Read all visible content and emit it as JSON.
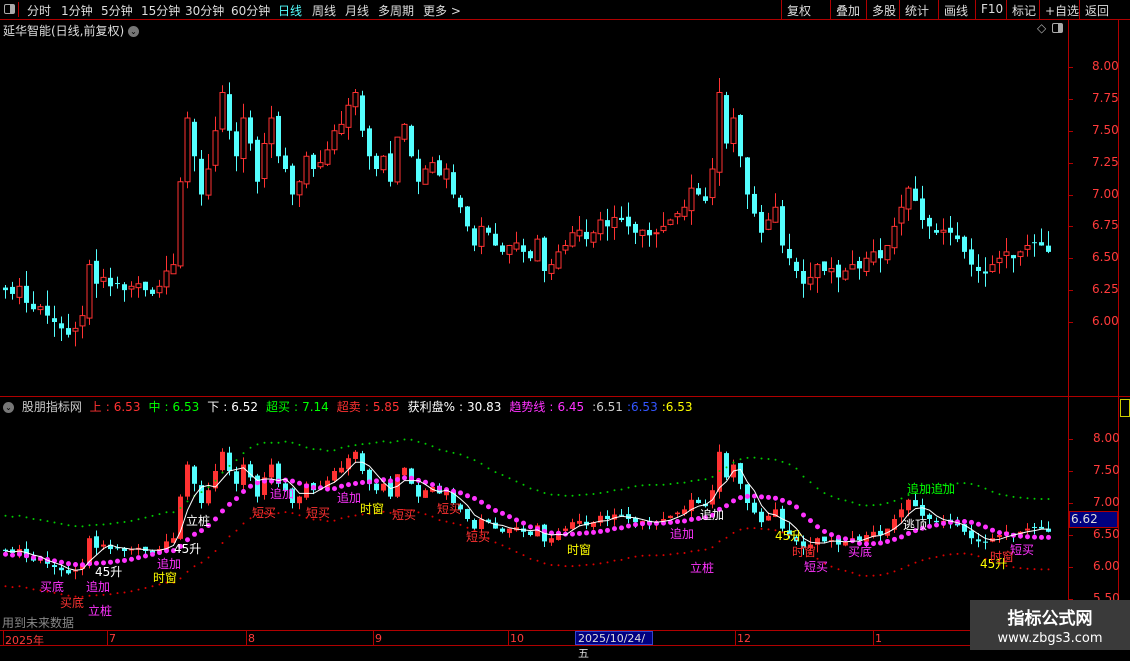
{
  "toolbar": {
    "periods": [
      "分时",
      "1分钟",
      "5分钟",
      "15分钟",
      "30分钟",
      "60分钟",
      "日线",
      "周线",
      "月线",
      "多周期",
      "更多 >"
    ],
    "active_period": "日线",
    "right_buttons": [
      "复权",
      "叠加",
      "多股",
      "统计",
      "画线",
      "F10",
      "标记",
      "+自选",
      "返回"
    ]
  },
  "main_chart": {
    "title": "延华智能(日线,前复权)",
    "y_ticks": [
      "8.00",
      "7.75",
      "7.50",
      "7.25",
      "7.00",
      "6.75",
      "6.50",
      "6.25",
      "6.00"
    ],
    "closes": [
      6.25,
      6.22,
      6.28,
      6.15,
      6.1,
      6.12,
      6.05,
      6.0,
      5.95,
      5.9,
      5.95,
      6.05,
      6.45,
      6.3,
      6.35,
      6.28,
      6.3,
      6.25,
      6.28,
      6.3,
      6.25,
      6.22,
      6.28,
      6.4,
      6.45,
      7.1,
      7.6,
      7.3,
      7.0,
      7.2,
      7.5,
      7.8,
      7.5,
      7.3,
      7.6,
      7.4,
      7.1,
      7.4,
      7.6,
      7.3,
      7.2,
      7.0,
      7.1,
      7.3,
      7.2,
      7.25,
      7.35,
      7.5,
      7.55,
      7.7,
      7.8,
      7.5,
      7.3,
      7.2,
      7.3,
      7.1,
      7.45,
      7.55,
      7.3,
      7.1,
      7.2,
      7.25,
      7.15,
      7.2,
      7.0,
      6.9,
      6.75,
      6.6,
      6.75,
      6.7,
      6.6,
      6.55,
      6.6,
      6.62,
      6.55,
      6.5,
      6.65,
      6.4,
      6.45,
      6.55,
      6.6,
      6.7,
      6.72,
      6.65,
      6.7,
      6.8,
      6.75,
      6.82,
      6.8,
      6.75,
      6.7,
      6.72,
      6.68,
      6.7,
      6.75,
      6.8,
      6.85,
      6.9,
      7.05,
      7.0,
      6.95,
      7.2,
      7.8,
      7.4,
      7.6,
      7.3,
      7.0,
      6.85,
      6.7,
      6.8,
      6.9,
      6.6,
      6.5,
      6.4,
      6.3,
      6.35,
      6.45,
      6.4,
      6.42,
      6.35,
      6.4,
      6.45,
      6.42,
      6.5,
      6.55,
      6.5,
      6.6,
      6.75,
      6.9,
      7.05,
      6.95,
      6.8,
      6.75,
      6.7,
      6.72,
      6.7,
      6.65,
      6.55,
      6.45,
      6.4,
      6.38,
      6.45,
      6.5,
      6.55,
      6.5,
      6.55,
      6.6,
      6.62,
      6.6,
      6.55
    ],
    "colors": {
      "up": "#ff3232",
      "down": "#54ffff",
      "axis": "#b00000"
    }
  },
  "indicator": {
    "name": "股朋指标网",
    "fields": [
      {
        "label": "上",
        "value": "6.53",
        "color": "#ff3232"
      },
      {
        "label": "中",
        "value": "6.53",
        "color": "#00ff00"
      },
      {
        "label": "下",
        "value": "6.52",
        "color": "#ffffff"
      },
      {
        "label": "超买",
        "value": "7.14",
        "color": "#00ff00"
      },
      {
        "label": "超卖",
        "value": "5.85",
        "color": "#ff3232"
      },
      {
        "label": "获利盘%",
        "value": "30.83",
        "color": "#ffffff"
      },
      {
        "label": "趋势线",
        "value": "6.45",
        "color": "#ff33ff"
      }
    ],
    "extra_values": [
      {
        "value": "6.51",
        "color": "#cccccc"
      },
      {
        "value": "6.53",
        "color": "#3355ff"
      },
      {
        "value": "6.53",
        "color": "#ffff00"
      }
    ],
    "y_ticks": [
      "8.00",
      "7.50",
      "7.00",
      "6.50",
      "6.00",
      "5.50"
    ],
    "current_price": "6.62",
    "future_data_note": "用到未来数据",
    "signals": [
      "买底",
      "买底",
      "追加",
      "立桩",
      "45升",
      "追加",
      "时窗",
      "45升",
      "立桩",
      "短买",
      "追加",
      "短买",
      "追加",
      "时窗",
      "短买",
      "短买",
      "短买",
      "时窗",
      "追加",
      "立桩",
      "45升",
      "时窗",
      "短买",
      "买底",
      "追加追加",
      "逃顶",
      "45升",
      "时窗",
      "短买",
      "追加"
    ]
  },
  "time_axis": {
    "labels": [
      "2025年",
      "7",
      "8",
      "9",
      "10",
      "12",
      "1"
    ],
    "cursor_date": "2025/10/24/五"
  },
  "watermark": {
    "title": "指标公式网",
    "url": "www.zbgs3.com"
  }
}
